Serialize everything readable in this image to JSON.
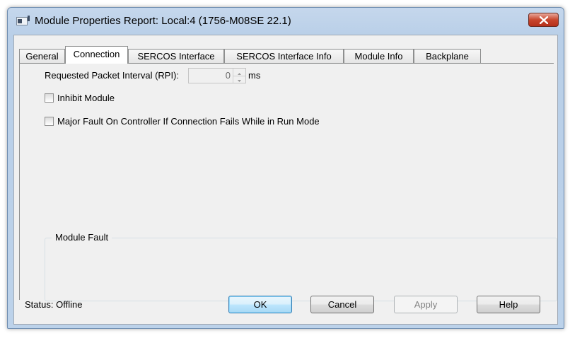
{
  "window": {
    "title": "Module Properties Report: Local:4 (1756-M08SE 22.1)",
    "icons": [
      "app-icon",
      "close-icon"
    ]
  },
  "tabs": [
    {
      "label": "General",
      "active": false
    },
    {
      "label": "Connection",
      "active": true
    },
    {
      "label": "SERCOS Interface",
      "active": false
    },
    {
      "label": "SERCOS Interface Info",
      "active": false
    },
    {
      "label": "Module Info",
      "active": false
    },
    {
      "label": "Backplane",
      "active": false
    }
  ],
  "connection": {
    "rpi_label": "Requested Packet Interval (RPI):",
    "rpi_value": "0",
    "rpi_unit": "ms",
    "inhibit_label": "Inhibit Module",
    "inhibit_checked": false,
    "major_fault_label": "Major Fault On Controller If Connection Fails While in Run Mode",
    "major_fault_checked": false,
    "module_fault_title": "Module Fault",
    "module_fault_text": ""
  },
  "footer": {
    "status_label": "Status:",
    "status_value": "Offline",
    "ok": "OK",
    "cancel": "Cancel",
    "apply": "Apply",
    "help": "Help"
  },
  "colors": {
    "title_bar": "#b9cfe8",
    "close_button": "#c8452c",
    "default_button": "#bee6fd",
    "dialog_background": "#f0f0f0"
  }
}
